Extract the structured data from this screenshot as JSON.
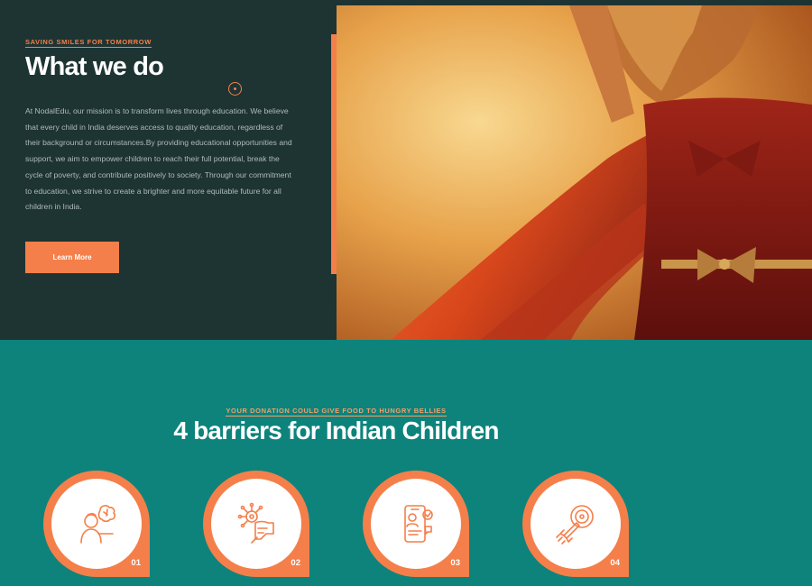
{
  "hero": {
    "eyebrow": "SAVING SMILES FOR TOMORROW",
    "title": "What we do",
    "body": "At NodalEdu, our mission is to transform lives through education. We believe that every child in India deserves access to quality education, regardless of their background or circumstances.By providing educational opportunities and support, we aim to empower children to reach their full potential, break the cycle of poverty, and contribute positively to society. Through our commitment to education, we strive to create a brighter and more equitable future for all children in India.",
    "button_label": "Learn More"
  },
  "barriers": {
    "eyebrow": "YOUR DONATION COULD GIVE FOOD TO HUNGRY BELLIES",
    "title": "4 barriers for Indian Children",
    "cards": [
      {
        "number": "01",
        "icon": "child-thinking-icon"
      },
      {
        "number": "02",
        "icon": "hand-circuit-icon"
      },
      {
        "number": "03",
        "icon": "mobile-profile-icon"
      },
      {
        "number": "04",
        "icon": "rocket-target-icon"
      }
    ]
  },
  "colors": {
    "accent": "#f47f4a",
    "hero_bg": "#1e3433",
    "section_bg": "#0d837c"
  }
}
